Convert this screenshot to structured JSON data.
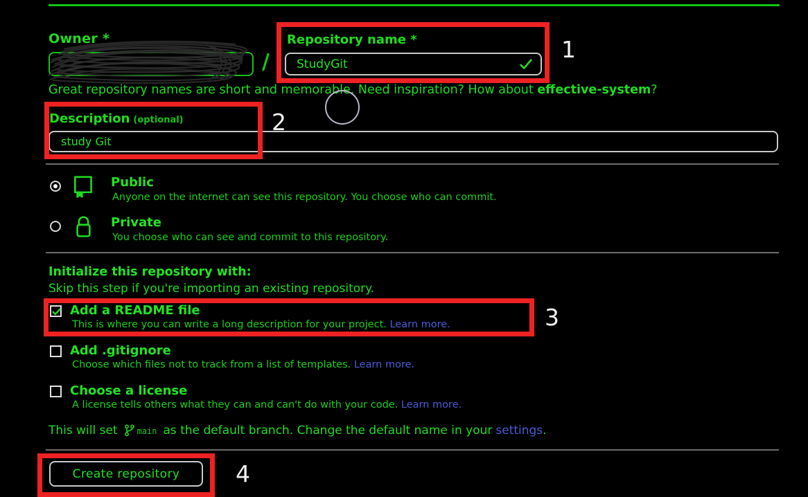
{
  "form": {
    "owner": {
      "label": "Owner *",
      "value": "",
      "redacted": true
    },
    "separator": "/",
    "repository_name": {
      "label": "Repository name *",
      "value": "StudyGit",
      "valid_icon": "check-icon"
    },
    "hint": {
      "text": "Great repository names are short and memorable. Need inspiration? How about ",
      "suggestion": "effective-system",
      "tail": "?"
    },
    "description": {
      "label": "Description",
      "optional_label": "(optional)",
      "value": "study Git"
    },
    "visibility": [
      {
        "id": "public",
        "title": "Public",
        "description": "Anyone on the internet can see this repository. You choose who can commit.",
        "selected": true,
        "icon": "repository-book-icon"
      },
      {
        "id": "private",
        "title": "Private",
        "description": "You choose who can see and commit to this repository.",
        "selected": false,
        "icon": "lock-icon"
      }
    ],
    "initialize": {
      "title": "Initialize this repository with:",
      "subtitle": "Skip this step if you're importing an existing repository.",
      "options": [
        {
          "id": "readme",
          "title": "Add a README file",
          "description": "This is where you can write a long description for your project.",
          "link": "Learn more.",
          "checked": true
        },
        {
          "id": "gitignore",
          "title": "Add .gitignore",
          "description": "Choose which files not to track from a list of templates.",
          "link": "Learn more.",
          "checked": false
        },
        {
          "id": "license",
          "title": "Choose a license",
          "description": "A license tells others what they can and can't do with your code.",
          "link": "Learn more.",
          "checked": false
        }
      ]
    },
    "branch_note": {
      "prefix": "This will set",
      "branch_icon": "git-branch-icon",
      "branch_name": "main",
      "middle": "as the default branch. Change the default name in your",
      "link": "settings",
      "suffix": "."
    },
    "submit": {
      "label": "Create repository"
    }
  },
  "annotations": [
    {
      "id": "1",
      "label": "1",
      "target": "repository-name-field"
    },
    {
      "id": "2",
      "label": "2",
      "target": "description-field"
    },
    {
      "id": "3",
      "label": "3",
      "target": "readme-checkbox"
    },
    {
      "id": "4",
      "label": "4",
      "target": "create-repository-button"
    }
  ],
  "colors": {
    "background": "#000000",
    "text_green": "#1fdd1f",
    "bright_green": "#22e322",
    "link_blue": "#4b5bd8",
    "annotation_red": "#ee2222",
    "marker_white": "#f2f2f2",
    "divider_gray": "#6c6c6c",
    "field_border": "#c9c9c9"
  }
}
